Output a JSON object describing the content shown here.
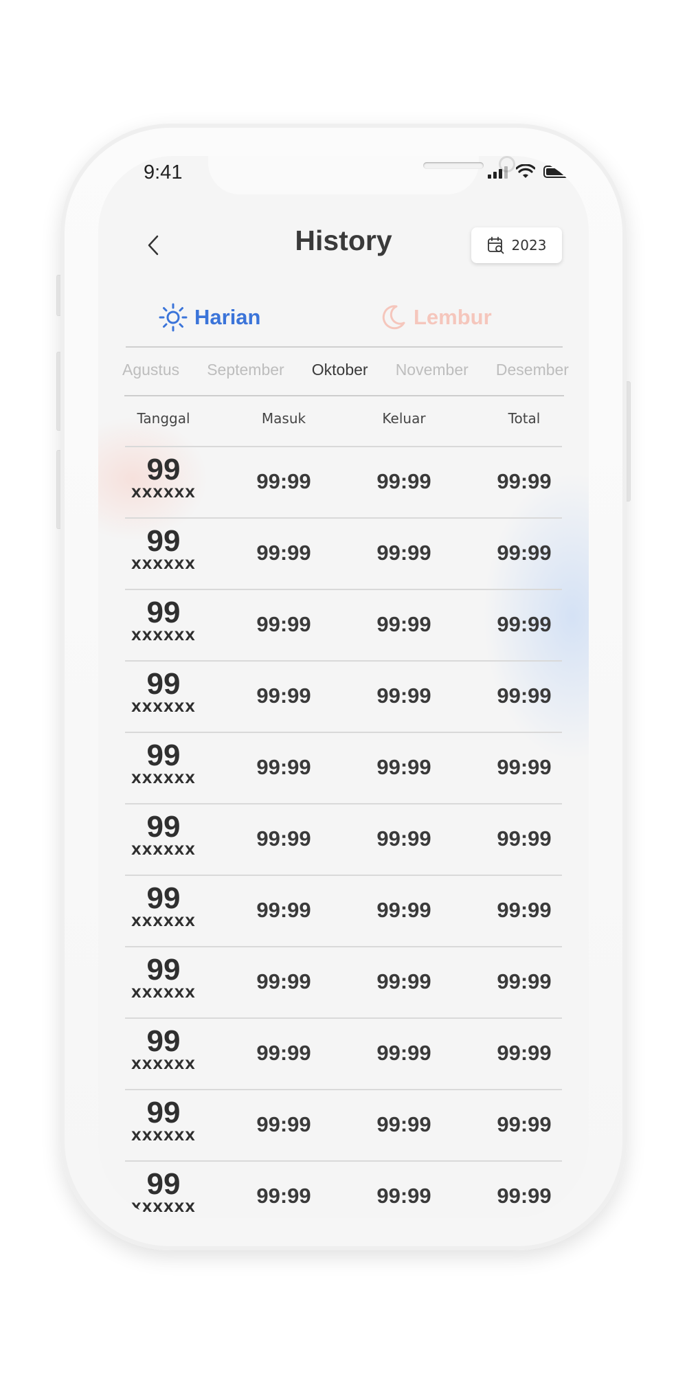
{
  "status_bar": {
    "time": "9:41"
  },
  "header": {
    "title": "History",
    "year": "2023"
  },
  "tabs": [
    {
      "label": "Harian",
      "icon": "sun-icon",
      "color": "#3b74d9",
      "active": true
    },
    {
      "label": "Lembur",
      "icon": "moon-icon",
      "color": "#f5c6bc",
      "active": false
    }
  ],
  "months": [
    "Agustus",
    "September",
    "Oktober",
    "November",
    "Desember"
  ],
  "active_month": "Oktober",
  "table": {
    "columns": [
      "Tanggal",
      "Masuk",
      "Keluar",
      "Total"
    ],
    "rows": [
      {
        "day": "99",
        "sub": "XXXXXX",
        "masuk": "99:99",
        "keluar": "99:99",
        "total": "99:99"
      },
      {
        "day": "99",
        "sub": "XXXXXX",
        "masuk": "99:99",
        "keluar": "99:99",
        "total": "99:99"
      },
      {
        "day": "99",
        "sub": "XXXXXX",
        "masuk": "99:99",
        "keluar": "99:99",
        "total": "99:99"
      },
      {
        "day": "99",
        "sub": "XXXXXX",
        "masuk": "99:99",
        "keluar": "99:99",
        "total": "99:99"
      },
      {
        "day": "99",
        "sub": "XXXXXX",
        "masuk": "99:99",
        "keluar": "99:99",
        "total": "99:99"
      },
      {
        "day": "99",
        "sub": "XXXXXX",
        "masuk": "99:99",
        "keluar": "99:99",
        "total": "99:99"
      },
      {
        "day": "99",
        "sub": "XXXXXX",
        "masuk": "99:99",
        "keluar": "99:99",
        "total": "99:99"
      },
      {
        "day": "99",
        "sub": "XXXXXX",
        "masuk": "99:99",
        "keluar": "99:99",
        "total": "99:99"
      },
      {
        "day": "99",
        "sub": "XXXXXX",
        "masuk": "99:99",
        "keluar": "99:99",
        "total": "99:99"
      },
      {
        "day": "99",
        "sub": "XXXXXX",
        "masuk": "99:99",
        "keluar": "99:99",
        "total": "99:99"
      },
      {
        "day": "99",
        "sub": "XXXXXX",
        "masuk": "99:99",
        "keluar": "99:99",
        "total": "99:99"
      }
    ]
  }
}
